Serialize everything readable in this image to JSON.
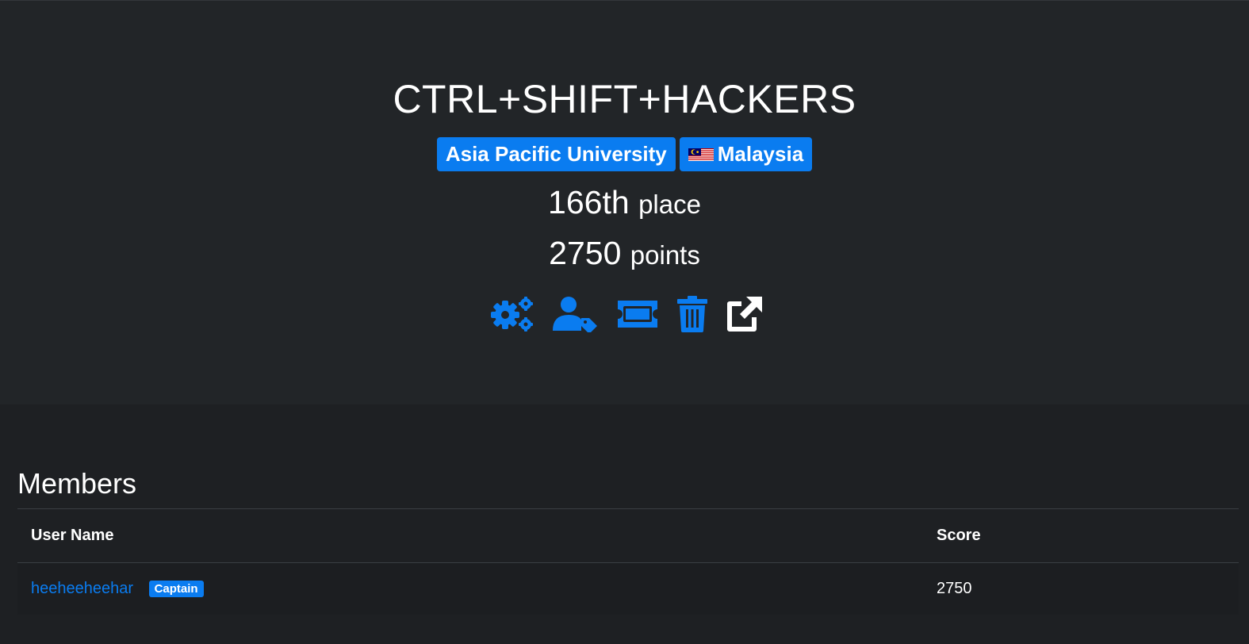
{
  "team": {
    "name": "CTRL+SHIFT+HACKERS",
    "affiliation": "Asia Pacific University",
    "country": "Malaysia",
    "place_value": "166th",
    "place_unit": "place",
    "points_value": "2750",
    "points_unit": "points"
  },
  "actions": [
    {
      "icon": "gears-icon"
    },
    {
      "icon": "user-tag-icon"
    },
    {
      "icon": "ticket-icon"
    },
    {
      "icon": "trash-icon"
    },
    {
      "icon": "external-link-icon"
    }
  ],
  "members": {
    "title": "Members",
    "columns": [
      "User Name",
      "Score"
    ],
    "rows": [
      {
        "name": "heeheeheehar",
        "badge": "Captain",
        "score": "2750"
      }
    ]
  },
  "colors": {
    "accent": "#0a7cf0",
    "page_bg": "#1e2023",
    "header_bg": "#222528"
  }
}
